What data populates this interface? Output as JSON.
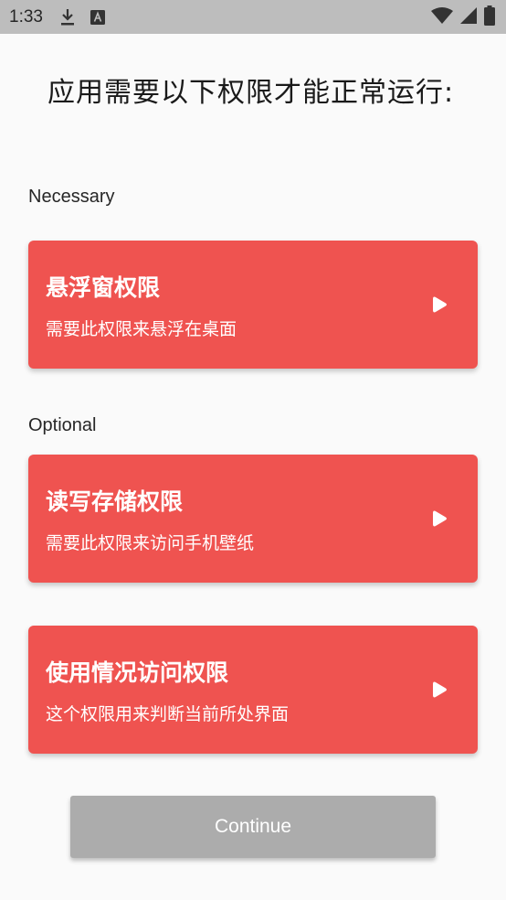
{
  "status_bar": {
    "time": "1:33",
    "icons": [
      "download-icon",
      "keyboard-a-icon",
      "wifi-icon",
      "signal-icon",
      "battery-icon"
    ]
  },
  "page": {
    "title": "应用需要以下权限才能正常运行:"
  },
  "sections": {
    "necessary_label": "Necessary",
    "optional_label": "Optional"
  },
  "permissions": [
    {
      "title": "悬浮窗权限",
      "description": "需要此权限来悬浮在桌面"
    },
    {
      "title": "读写存储权限",
      "description": "需要此权限来访问手机壁纸"
    },
    {
      "title": "使用情况访问权限",
      "description": "这个权限用来判断当前所处界面"
    }
  ],
  "continue_button": {
    "label": "Continue"
  },
  "colors": {
    "card_background": "#ef5350",
    "button_disabled": "#acacac",
    "status_bar": "#bdbdbd",
    "background": "#fafafa"
  }
}
